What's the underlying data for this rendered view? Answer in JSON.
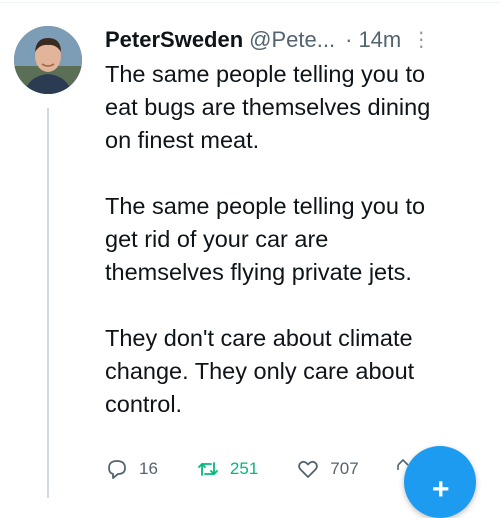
{
  "tweet": {
    "author_name": "PeterSweden",
    "author_handle": "@Pete...",
    "separator": "·",
    "timestamp": "14m",
    "more_glyph": "⋮",
    "text": "The same people telling you to\neat bugs are themselves dining\non finest meat.\n\nThe same people telling you to\nget rid of your car are\nthemselves flying private jets.\n\nThey don't care about climate\nchange. They only care about\ncontrol."
  },
  "actions": {
    "replies": "16",
    "retweets": "251",
    "likes": "707"
  },
  "icons": {
    "reply": "reply-icon",
    "retweet": "retweet-icon",
    "like": "heart-icon",
    "share": "share-icon",
    "compose": "plus-icon"
  },
  "colors": {
    "brand": "#1d9bf0",
    "retweet_active": "#00ba7c",
    "secondary_text": "#536471"
  },
  "fab": {
    "label": "+"
  }
}
